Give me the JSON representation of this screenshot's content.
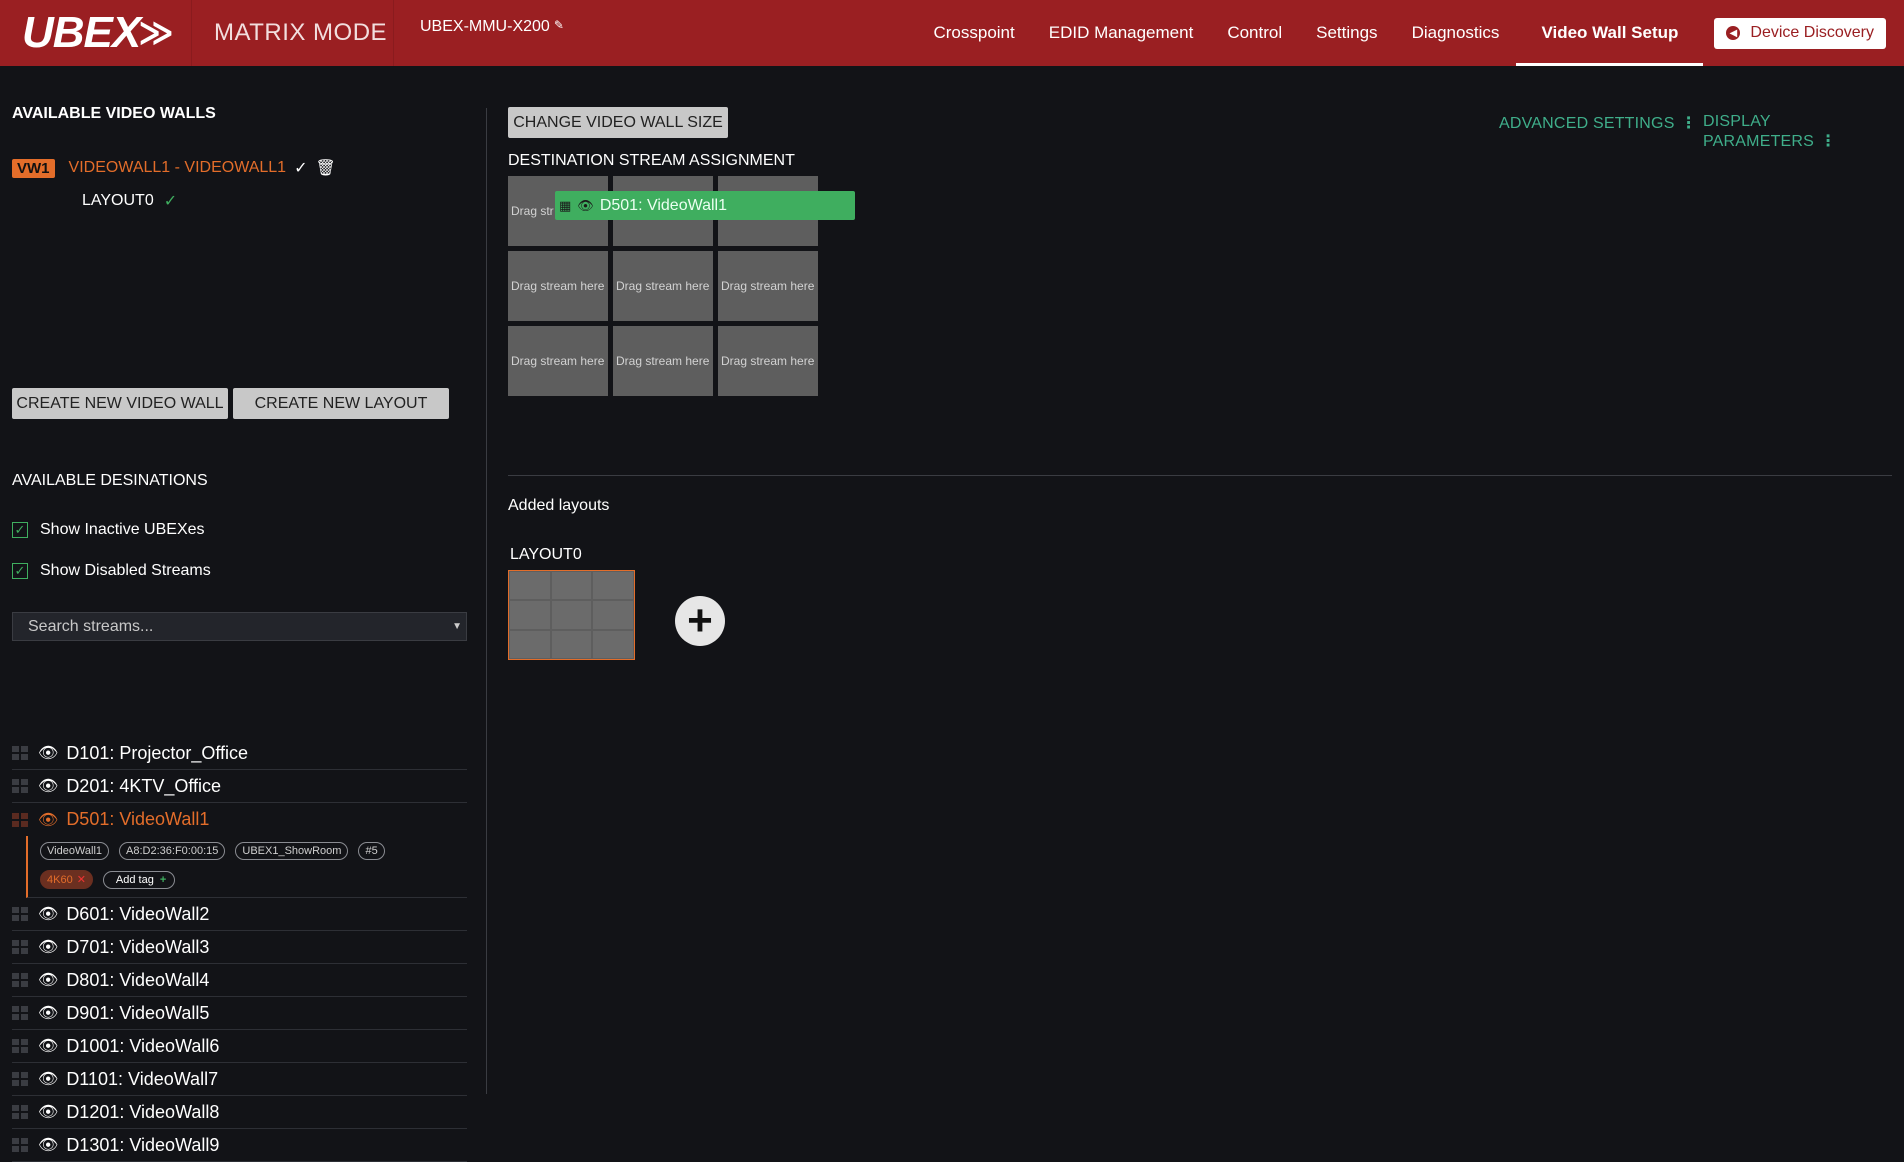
{
  "header": {
    "logo": "UBEX",
    "mode": "MATRIX MODE",
    "device_name": "UBEX-MMU-X200",
    "nav": [
      "Crosspoint",
      "EDID Management",
      "Control",
      "Settings",
      "Diagnostics",
      "Video Wall Setup"
    ],
    "active_nav": "Video Wall Setup",
    "discovery_label": "Device Discovery"
  },
  "left": {
    "walls_title": "AVAILABLE VIDEO WALLS",
    "wall": {
      "badge": "VW1",
      "name": "VIDEOWALL1 - VIDEOWALL1"
    },
    "layout": "LAYOUT0",
    "btn_new_wall": "CREATE NEW VIDEO WALL",
    "btn_new_layout": "CREATE NEW LAYOUT",
    "dest_title": "AVAILABLE DESINATIONS",
    "chk_inactive": "Show Inactive UBEXes",
    "chk_disabled": "Show Disabled Streams",
    "search_placeholder": "Search streams...",
    "streams": [
      "D101: Projector_Office",
      "D201: 4KTV_Office",
      "D501: VideoWall1",
      "D601: VideoWall2",
      "D701: VideoWall3",
      "D801: VideoWall4",
      "D901: VideoWall5",
      "D1001: VideoWall6",
      "D1101: VideoWall7",
      "D1201: VideoWall8",
      "D1301: VideoWall9"
    ],
    "tags": [
      "VideoWall1",
      "A8:D2:36:F0:00:15",
      "UBEX1_ShowRoom",
      "#5"
    ],
    "res_tag": "4K60",
    "add_tag": "Add tag"
  },
  "right": {
    "btn_size": "CHANGE VIDEO WALL SIZE",
    "advanced": "ADVANCED SETTINGS",
    "display_params": "DISPLAY PARAMETERS",
    "dsa_title": "DESTINATION STREAM ASSIGNMENT",
    "cell_text": "Drag stream here",
    "cell_partial": "Drag str",
    "drag_ghost": "D501: VideoWall1",
    "added_title": "Added layouts",
    "layout_name": "LAYOUT0"
  },
  "colors": {
    "header": "#9a1f22",
    "accent": "#e36d2a",
    "green": "#3fae5f"
  }
}
